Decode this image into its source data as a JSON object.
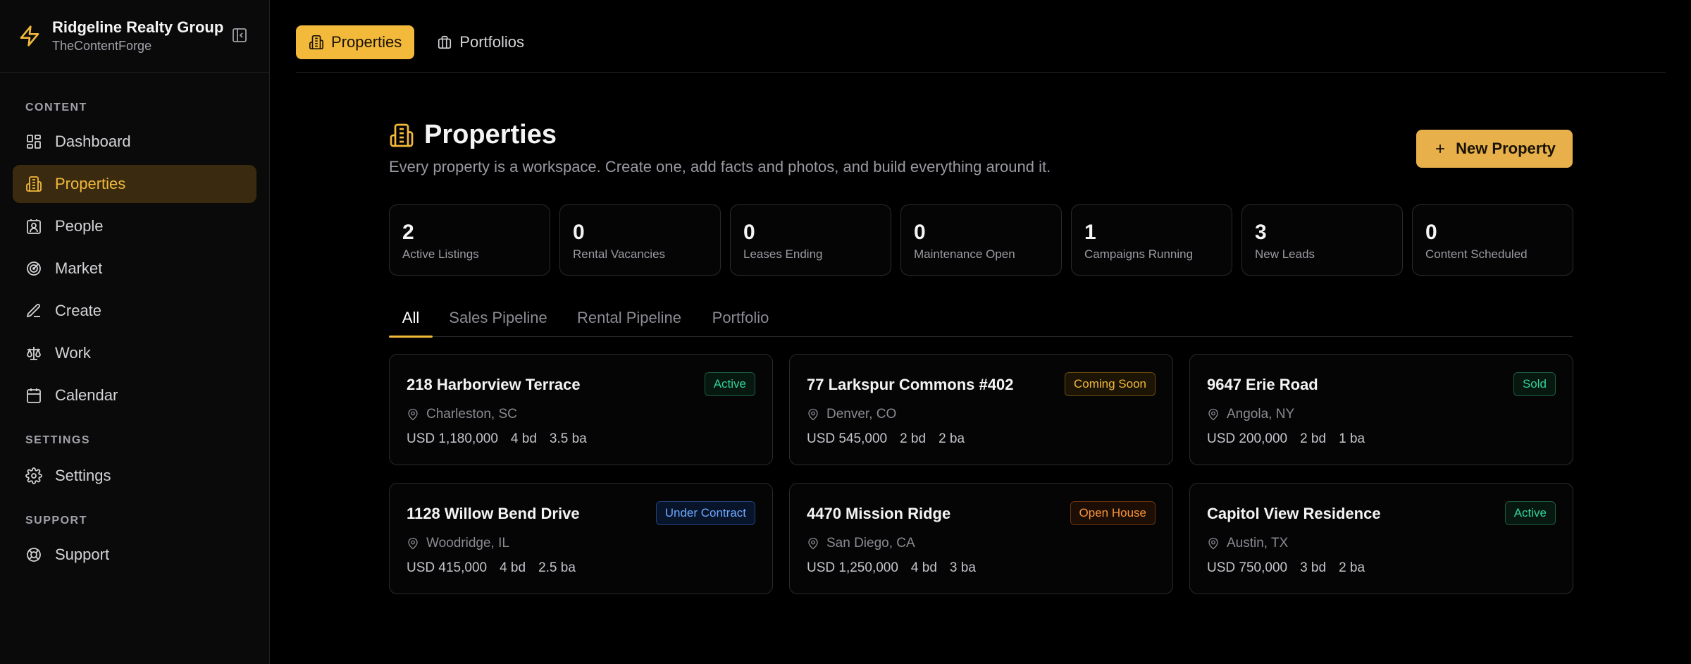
{
  "brand": {
    "name": "Ridgeline Realty Group",
    "sub": "TheContentForge"
  },
  "sidebar": {
    "sections": {
      "content": "CONTENT",
      "settings": "SETTINGS",
      "support": "SUPPORT"
    },
    "items": [
      {
        "label": "Dashboard",
        "icon": "dashboard-icon"
      },
      {
        "label": "Properties",
        "icon": "building-icon"
      },
      {
        "label": "People",
        "icon": "contact-icon"
      },
      {
        "label": "Market",
        "icon": "target-icon"
      },
      {
        "label": "Create",
        "icon": "pen-icon"
      },
      {
        "label": "Work",
        "icon": "scale-icon"
      },
      {
        "label": "Calendar",
        "icon": "calendar-icon"
      },
      {
        "label": "Settings",
        "icon": "gear-icon"
      },
      {
        "label": "Support",
        "icon": "lifebuoy-icon"
      }
    ]
  },
  "topnav": {
    "properties": "Properties",
    "portfolios": "Portfolios"
  },
  "page": {
    "title": "Properties",
    "subtitle": "Every property is a workspace. Create one, add facts and photos, and build everything around it.",
    "new_button": "New Property"
  },
  "stats": [
    {
      "value": "2",
      "label": "Active Listings"
    },
    {
      "value": "0",
      "label": "Rental Vacancies"
    },
    {
      "value": "0",
      "label": "Leases Ending"
    },
    {
      "value": "0",
      "label": "Maintenance Open"
    },
    {
      "value": "1",
      "label": "Campaigns Running"
    },
    {
      "value": "3",
      "label": "New Leads"
    },
    {
      "value": "0",
      "label": "Content Scheduled"
    }
  ],
  "tabs": [
    "All",
    "Sales Pipeline",
    "Rental Pipeline",
    "Portfolio"
  ],
  "properties": [
    {
      "title": "218 Harborview Terrace",
      "status": "Active",
      "location": "Charleston, SC",
      "price": "USD 1,180,000",
      "beds": "4 bd",
      "baths": "3.5 ba"
    },
    {
      "title": "77 Larkspur Commons #402",
      "status": "Coming Soon",
      "location": "Denver, CO",
      "price": "USD 545,000",
      "beds": "2 bd",
      "baths": "2 ba"
    },
    {
      "title": "9647 Erie Road",
      "status": "Sold",
      "location": "Angola, NY",
      "price": "USD 200,000",
      "beds": "2 bd",
      "baths": "1 ba"
    },
    {
      "title": "1128 Willow Bend Drive",
      "status": "Under Contract",
      "location": "Woodridge, IL",
      "price": "USD 415,000",
      "beds": "4 bd",
      "baths": "2.5 ba"
    },
    {
      "title": "4470 Mission Ridge",
      "status": "Open House",
      "location": "San Diego, CA",
      "price": "USD 1,250,000",
      "beds": "4 bd",
      "baths": "3 ba"
    },
    {
      "title": "Capitol View Residence",
      "status": "Active",
      "location": "Austin, TX",
      "price": "USD 750,000",
      "beds": "3 bd",
      "baths": "2 ba"
    }
  ],
  "colors": {
    "accent": "#f2b93b",
    "background": "#000000",
    "sidebar": "#0a0a0a"
  }
}
